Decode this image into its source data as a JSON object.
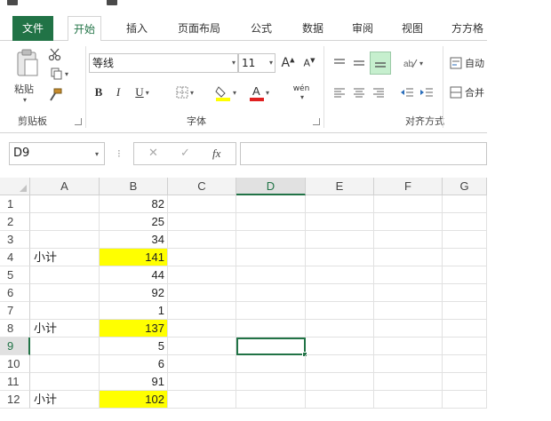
{
  "tabs": [
    {
      "label": "文件",
      "name": "tab-file"
    },
    {
      "label": "开始",
      "name": "tab-home"
    },
    {
      "label": "插入",
      "name": "tab-insert"
    },
    {
      "label": "页面布局",
      "name": "tab-page-layout"
    },
    {
      "label": "公式",
      "name": "tab-formulas"
    },
    {
      "label": "数据",
      "name": "tab-data"
    },
    {
      "label": "审阅",
      "name": "tab-review"
    },
    {
      "label": "视图",
      "name": "tab-view"
    },
    {
      "label": "方方格",
      "name": "tab-addin"
    }
  ],
  "ribbon": {
    "clipboard": {
      "paste_label": "粘贴",
      "group_label": "剪贴板"
    },
    "font": {
      "font_name": "等线",
      "font_size": "11",
      "group_label": "字体",
      "bold": "B",
      "italic": "I",
      "underline": "U",
      "phonetic": "wén"
    },
    "alignment": {
      "wrap_label": "自动",
      "merge_label": "合并",
      "group_label": "对齐方式"
    }
  },
  "formula_bar": {
    "name_box": "D9",
    "fx": "fx",
    "cancel": "✕",
    "enter": "✓",
    "formula": ""
  },
  "columns": [
    "A",
    "B",
    "C",
    "D",
    "E",
    "F",
    "G"
  ],
  "selected_column": "D",
  "selected_row": 9,
  "rows": [
    {
      "num": "1",
      "a": "",
      "b": "82",
      "hl": false
    },
    {
      "num": "2",
      "a": "",
      "b": "25",
      "hl": false
    },
    {
      "num": "3",
      "a": "",
      "b": "34",
      "hl": false
    },
    {
      "num": "4",
      "a": "小计",
      "b": "141",
      "hl": true
    },
    {
      "num": "5",
      "a": "",
      "b": "44",
      "hl": false
    },
    {
      "num": "6",
      "a": "",
      "b": "92",
      "hl": false
    },
    {
      "num": "7",
      "a": "",
      "b": "1",
      "hl": false
    },
    {
      "num": "8",
      "a": "小计",
      "b": "137",
      "hl": true
    },
    {
      "num": "9",
      "a": "",
      "b": "5",
      "hl": false
    },
    {
      "num": "10",
      "a": "",
      "b": "6",
      "hl": false
    },
    {
      "num": "11",
      "a": "",
      "b": "91",
      "hl": false
    },
    {
      "num": "12",
      "a": "小计",
      "b": "102",
      "hl": true
    }
  ],
  "colors": {
    "accent": "#217346",
    "highlight": "#ffff00"
  }
}
